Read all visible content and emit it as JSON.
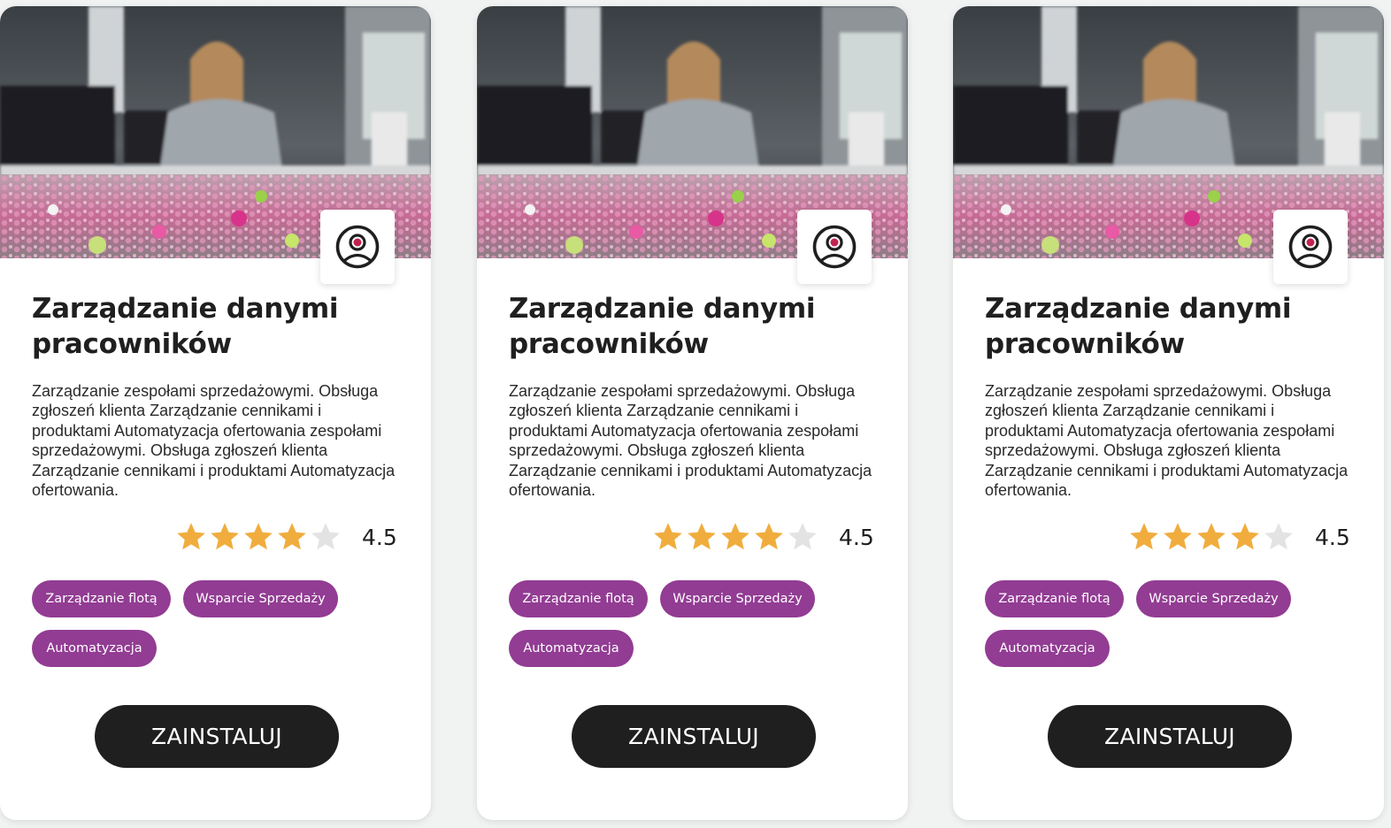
{
  "colors": {
    "page_background": "#f1f3f3",
    "card_background": "#ffffff",
    "title_text": "#1f1f1f",
    "tag_background": "#923c93",
    "tag_text": "#ffffff",
    "star_filled": "#f0ad3e",
    "star_empty": "#e3e3e3",
    "button_background": "#1f1f1f",
    "button_text": "#ffffff",
    "icon_accent": "#c2224f"
  },
  "cards": [
    {
      "image": "office-worker-with-colorful-beads-photo",
      "icon": "user-profile-icon",
      "title": "Zarządzanie danymi pracowników",
      "description": "Zarządzanie zespołami sprzedażowymi. Obsługa zgłoszeń klienta Zarządzanie cennikami i produktami Automatyzacja ofertowania zespołami sprzedażowymi. Obsługa zgłoszeń klienta Zarządzanie cennikami i produktami Automatyzacja ofertowania.",
      "rating": 4.5,
      "rating_label": "4.5",
      "stars_shown": {
        "filled": 4,
        "total": 5
      },
      "tags": [
        "Zarządzanie flotą",
        "Wsparcie Sprzedaży",
        "Automatyzacja"
      ],
      "install_label": "ZAINSTALUJ"
    },
    {
      "image": "office-worker-with-colorful-beads-photo",
      "icon": "user-profile-icon",
      "title": "Zarządzanie danymi pracowników",
      "description": "Zarządzanie zespołami sprzedażowymi. Obsługa zgłoszeń klienta Zarządzanie cennikami i produktami Automatyzacja ofertowania zespołami sprzedażowymi. Obsługa zgłoszeń klienta Zarządzanie cennikami i produktami Automatyzacja ofertowania.",
      "rating": 4.5,
      "rating_label": "4.5",
      "stars_shown": {
        "filled": 4,
        "total": 5
      },
      "tags": [
        "Zarządzanie flotą",
        "Wsparcie Sprzedaży",
        "Automatyzacja"
      ],
      "install_label": "ZAINSTALUJ"
    },
    {
      "image": "office-worker-with-colorful-beads-photo",
      "icon": "user-profile-icon",
      "title": "Zarządzanie danymi pracowników",
      "description": "Zarządzanie zespołami sprzedażowymi. Obsługa zgłoszeń klienta Zarządzanie cennikami i produktami Automatyzacja ofertowania zespołami sprzedażowymi. Obsługa zgłoszeń klienta Zarządzanie cennikami i produktami Automatyzacja ofertowania.",
      "rating": 4.5,
      "rating_label": "4.5",
      "stars_shown": {
        "filled": 4,
        "total": 5
      },
      "tags": [
        "Zarządzanie flotą",
        "Wsparcie Sprzedaży",
        "Automatyzacja"
      ],
      "install_label": "ZAINSTALUJ"
    }
  ]
}
